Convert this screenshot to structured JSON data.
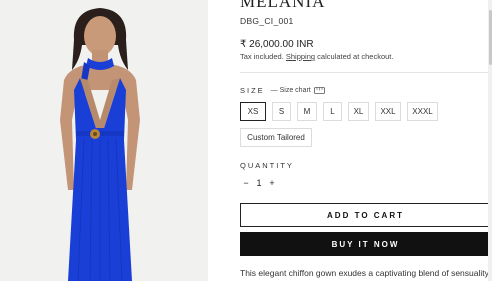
{
  "product": {
    "title": "MELANIA",
    "sku": "DBG_CI_001",
    "price": "₹ 26,000.00 INR",
    "tax_prefix": "Tax included. ",
    "tax_link": "Shipping",
    "tax_suffix": " calculated at checkout.",
    "description": "This elegant chiffon gown exudes a captivating blend of sensuality and"
  },
  "size": {
    "label": "SIZE",
    "chart_label": "— Size chart",
    "options": [
      "XS",
      "S",
      "M",
      "L",
      "XL",
      "XXL",
      "XXXL"
    ],
    "selected": "XS",
    "custom": "Custom Tailored"
  },
  "quantity": {
    "label": "QUANTITY",
    "value": "1",
    "minus": "−",
    "plus": "+"
  },
  "actions": {
    "add_to_cart": "ADD TO CART",
    "buy_now": "BUY IT NOW"
  },
  "colors": {
    "gown": "#1a3fd6",
    "button_dark": "#111111"
  }
}
